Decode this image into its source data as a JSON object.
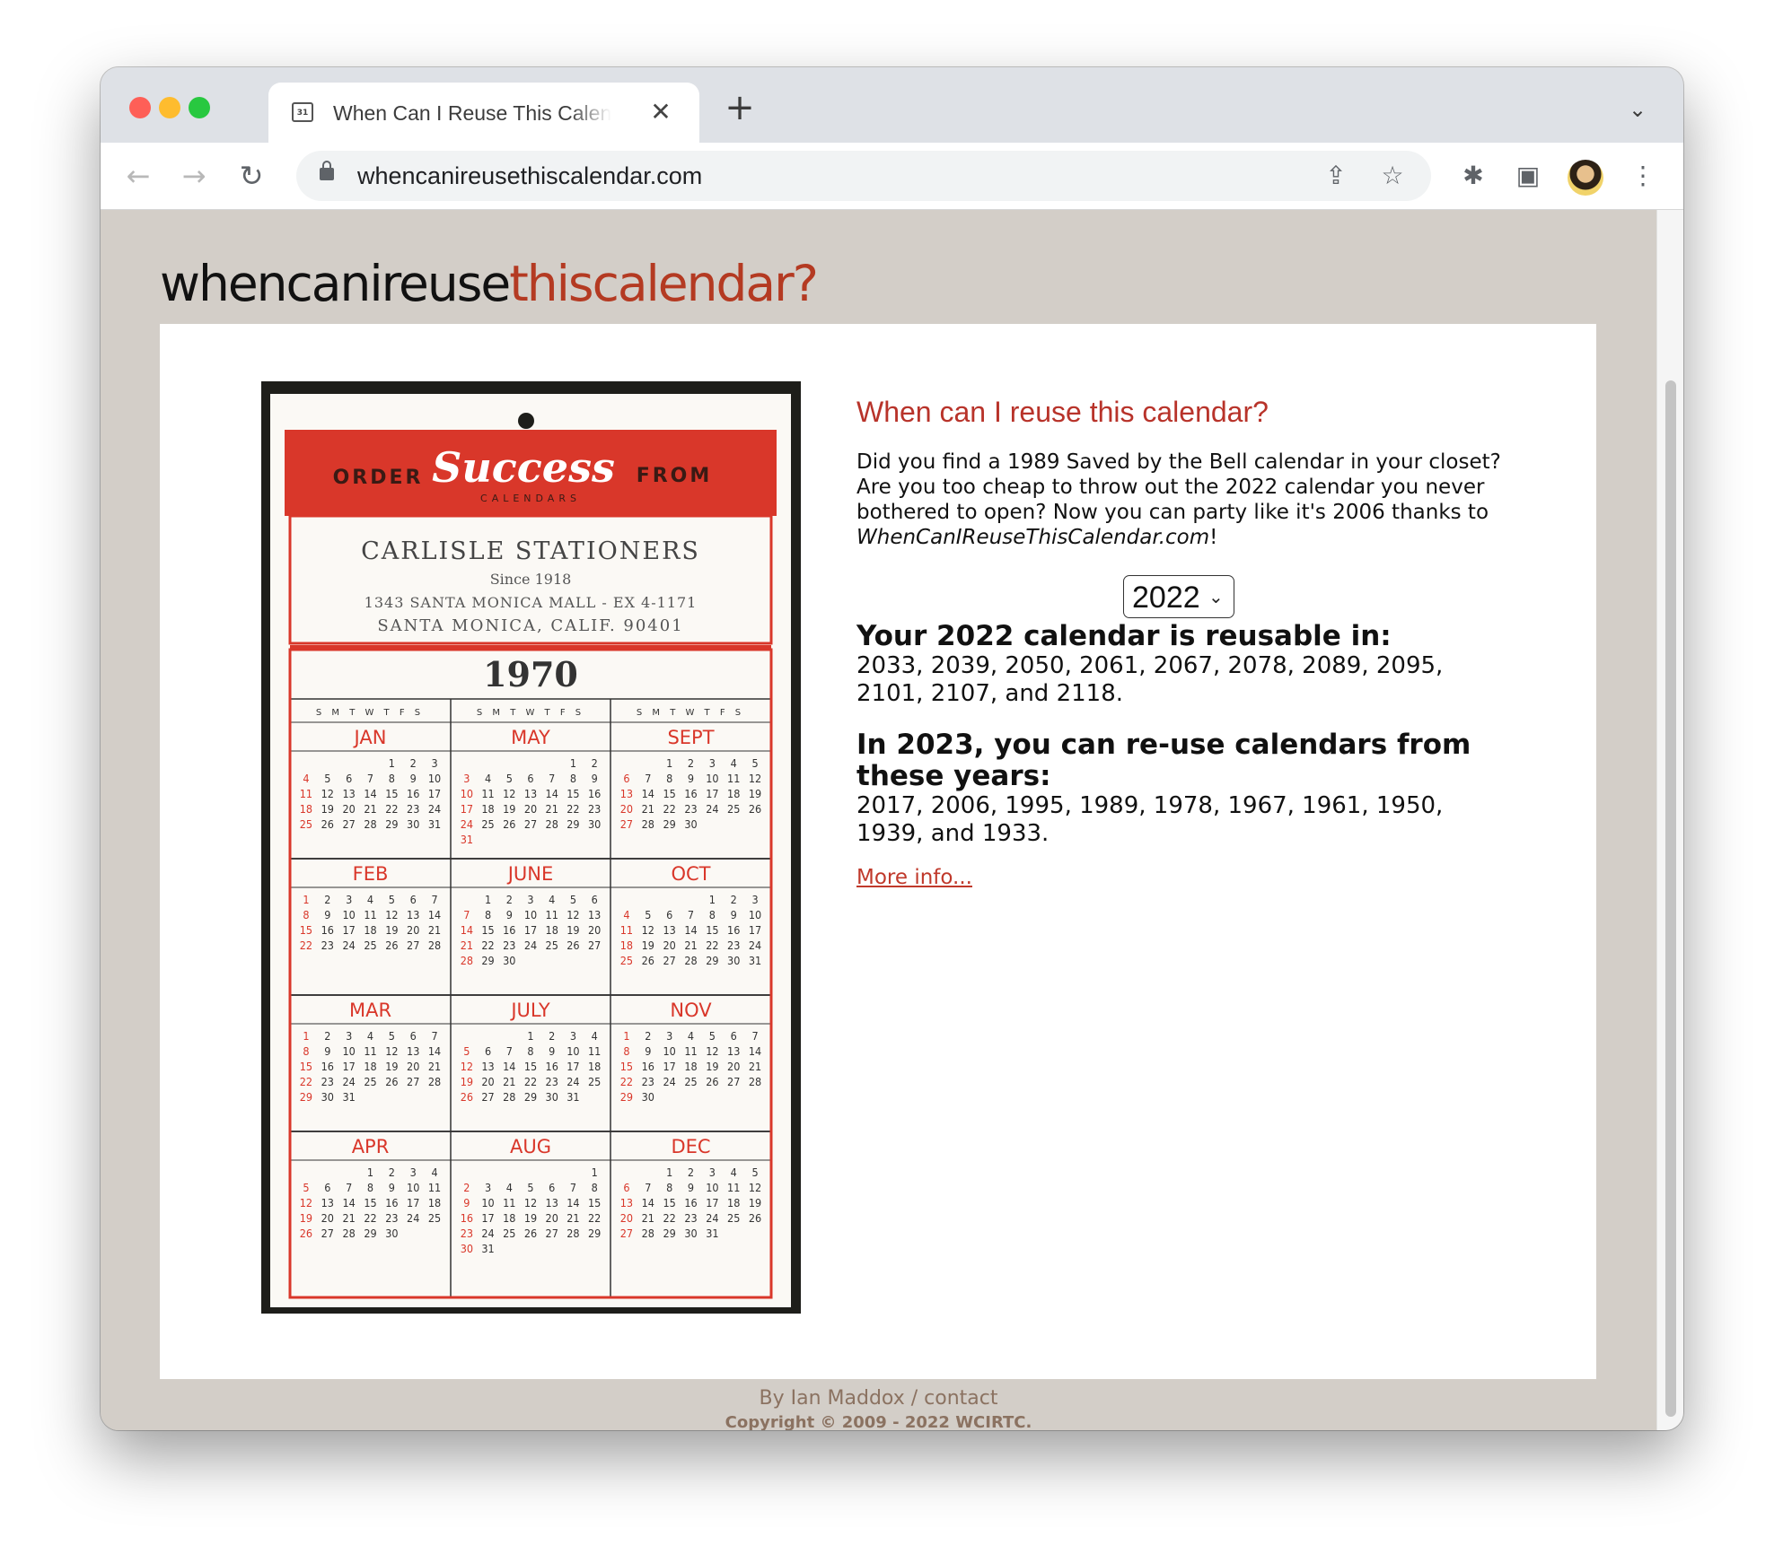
{
  "browser": {
    "tab_title": "When Can I Reuse This Calendar",
    "tab_favicon_text": "31",
    "tab_close": "✕",
    "new_tab": "+",
    "url": "whencanireusethiscalendar.com",
    "back": "←",
    "forward": "→",
    "reload": "↻",
    "share_icon": "⇪",
    "bookmark_icon": "☆",
    "extensions_icon": "✱",
    "sidepanel_icon": "▣",
    "menu_icon": "⋮",
    "tab_menu_icon": "⌄"
  },
  "site": {
    "logo_part1": "whencanireuse",
    "logo_part2": "thiscalendar?",
    "heading": "When can I reuse this calendar?",
    "intro_part1": "Did you find a 1989 Saved by the Bell calendar in your closet? Are you too cheap to throw out the 2022 calendar you never bothered to open? Now you can party like it's 2006 thanks to ",
    "intro_italic": "WhenCanIReuseThisCalendar.com",
    "intro_part2": "!",
    "selected_year": "2022",
    "reusable_heading": "Your 2022 calendar is reusable in:",
    "reusable_years": "2033, 2039, 2050, 2061, 2067, 2078, 2089, 2095, 2101, 2107, and 2118.",
    "reuse_from_heading": "In 2023, you can re-use calendars from these years:",
    "reuse_from_years": "2017, 2006, 1995, 1989, 1978, 1967, 1961, 1950, 1939, and 1933.",
    "more_info": "More info...",
    "footer_line": "By Ian Maddox / contact",
    "copyright": "Copyright © 2009 - 2022 WCIRTC."
  },
  "calendar_photo": {
    "order": "ORDER",
    "brand": "Success",
    "from": "FROM",
    "brand_sub": "CALENDARS",
    "store": "CARLISLE STATIONERS",
    "since": "Since 1918",
    "address": "1343 SANTA MONICA MALL - EX 4-1171",
    "city": "SANTA MONICA, CALIF. 90401",
    "year": "1970",
    "weekday_header": "S M T W T F S",
    "months": [
      {
        "name": "JAN",
        "first": 4,
        "days": 31
      },
      {
        "name": "MAY",
        "first": 5,
        "days": 31
      },
      {
        "name": "SEPT",
        "first": 2,
        "days": 30
      },
      {
        "name": "FEB",
        "first": 0,
        "days": 28
      },
      {
        "name": "JUNE",
        "first": 1,
        "days": 30
      },
      {
        "name": "OCT",
        "first": 4,
        "days": 31
      },
      {
        "name": "MAR",
        "first": 0,
        "days": 31
      },
      {
        "name": "JULY",
        "first": 3,
        "days": 31
      },
      {
        "name": "NOV",
        "first": 0,
        "days": 30
      },
      {
        "name": "APR",
        "first": 3,
        "days": 30
      },
      {
        "name": "AUG",
        "first": 6,
        "days": 31
      },
      {
        "name": "DEC",
        "first": 2,
        "days": 31
      }
    ],
    "colors": {
      "red": "#d9372a",
      "ink": "#333333",
      "paper": "#fbf9f5"
    }
  }
}
